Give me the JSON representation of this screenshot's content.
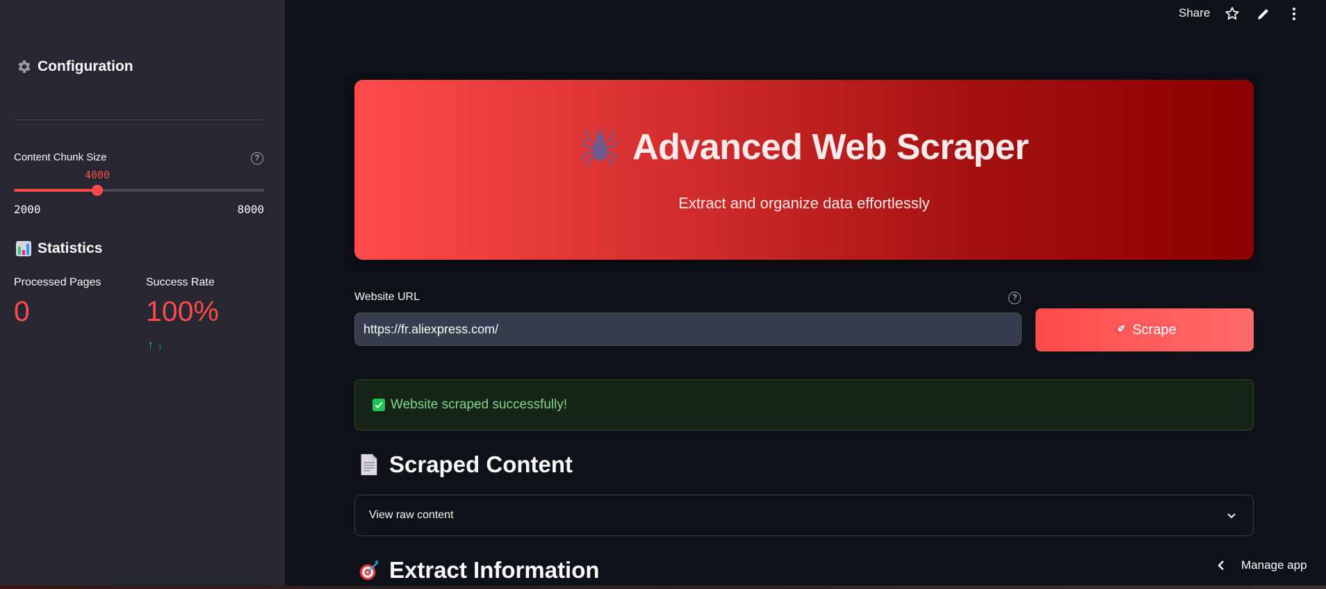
{
  "header": {
    "share_label": "Share",
    "icons": [
      "star-icon",
      "pencil-icon",
      "more-vertical-icon"
    ]
  },
  "sidebar": {
    "config_heading": "Configuration",
    "config_icon": "gear-icon",
    "slider": {
      "label": "Content Chunk Size",
      "value": 4000,
      "value_label": "4000",
      "min": 2000,
      "max": 8000,
      "min_label": "2000",
      "max_label": "8000",
      "fraction": 0.3333
    },
    "stats_heading": "Statistics",
    "stats_icon": "bar-chart-icon",
    "metrics": [
      {
        "label": "Processed Pages",
        "value": "0"
      },
      {
        "label": "Success Rate",
        "value": "100%",
        "delta": "↑",
        "delta_small": "↑"
      }
    ]
  },
  "hero": {
    "icon": "spider-icon",
    "title": "Advanced Web Scraper",
    "subtitle": "Extract and organize data effortlessly"
  },
  "url_input": {
    "label": "Website URL",
    "value": "https://fr.aliexpress.com/"
  },
  "scrape_button": {
    "icon": "rocket-icon",
    "label": "Scrape"
  },
  "success_message": {
    "text": "Website scraped successfully!"
  },
  "sections": {
    "scraped_content": {
      "icon": "document-icon",
      "title": "Scraped Content"
    },
    "expander_label": "View raw content",
    "extract_information": {
      "icon": "target-icon",
      "title": "Extract Information"
    }
  },
  "footer": {
    "manage_app_label": "Manage app"
  },
  "colors": {
    "accent": "#ff4b4b",
    "success": "#21c354",
    "sidebar_bg": "#262730",
    "main_bg": "#0e1117"
  }
}
